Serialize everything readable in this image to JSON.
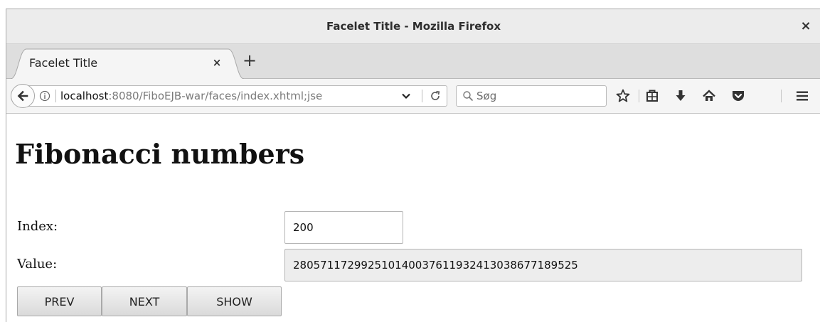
{
  "window": {
    "title": "Facelet Title - Mozilla Firefox",
    "close_label": "×"
  },
  "tab": {
    "label": "Facelet Title",
    "close_label": "×",
    "new_tab_label": "+"
  },
  "navbar": {
    "url_host": "localhost",
    "url_rest": ":8080/FiboEJB-war/faces/index.xhtml;jse",
    "search_placeholder": "Søg",
    "icons": [
      "back-arrow-icon",
      "info-icon",
      "dropdown-chevron-icon",
      "reload-icon",
      "search-icon",
      "star-icon",
      "reading-list-icon",
      "download-icon",
      "home-icon",
      "pocket-icon",
      "hamburger-menu-icon"
    ]
  },
  "page": {
    "heading": "Fibonacci numbers",
    "index_label": "Index:",
    "value_label": "Value:",
    "index_value": "200",
    "value_value": "280571172992510140037611932413038677189525",
    "buttons": {
      "prev": "PREV",
      "next": "NEXT",
      "show": "SHOW"
    }
  }
}
